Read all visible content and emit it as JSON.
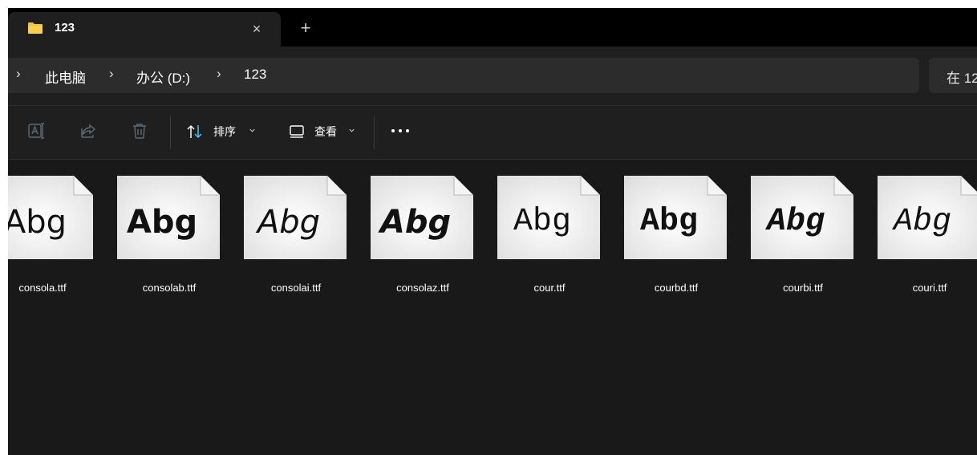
{
  "tab": {
    "title": "123",
    "close_glyph": "×",
    "new_tab_glyph": "+",
    "icon": "folder-icon"
  },
  "address": {
    "leading_chevron": "›",
    "crumbs": [
      "此电脑",
      "办公 (D:)",
      "123"
    ],
    "separator": "›"
  },
  "search": {
    "placeholder": "在 12"
  },
  "commandbar": {
    "icons": [
      "rename-icon",
      "share-icon",
      "delete-icon"
    ],
    "sort_label": "排序",
    "view_label": "查看",
    "more_icon": "more-icon"
  },
  "files": [
    {
      "name": "consola.ttf",
      "preview": "Abg",
      "family": "sans",
      "weight": "regular",
      "style": "normal"
    },
    {
      "name": "consolab.ttf",
      "preview": "Abg",
      "family": "sans",
      "weight": "bold",
      "style": "normal"
    },
    {
      "name": "consolai.ttf",
      "preview": "Abg",
      "family": "sans",
      "weight": "regular",
      "style": "italic"
    },
    {
      "name": "consolaz.ttf",
      "preview": "Abg",
      "family": "sans",
      "weight": "bold",
      "style": "italic"
    },
    {
      "name": "cour.ttf",
      "preview": "Abg",
      "family": "mono",
      "weight": "regular",
      "style": "normal"
    },
    {
      "name": "courbd.ttf",
      "preview": "Abg",
      "family": "mono",
      "weight": "bold",
      "style": "normal"
    },
    {
      "name": "courbi.ttf",
      "preview": "Abg",
      "family": "mono",
      "weight": "bold",
      "style": "italic"
    },
    {
      "name": "couri.ttf",
      "preview": "Abg",
      "family": "mono",
      "weight": "regular",
      "style": "italic"
    }
  ],
  "colors": {
    "window_bg": "#191919",
    "tabbar_bg": "#000000",
    "folder_yellow": "#f3c13a",
    "icon_disabled": "#5f6a74"
  }
}
